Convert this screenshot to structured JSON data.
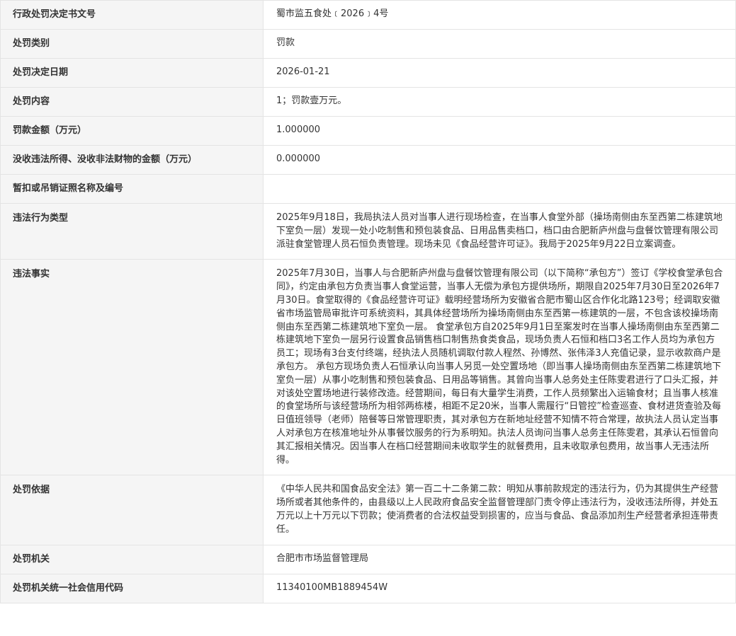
{
  "rows": [
    {
      "label": "行政处罚决定书文号",
      "value": "蜀市监五食处﹝2026﹞4号"
    },
    {
      "label": "处罚类别",
      "value": "罚款"
    },
    {
      "label": "处罚决定日期",
      "value": "2026-01-21"
    },
    {
      "label": "处罚内容",
      "value": "1；罚款壹万元。"
    },
    {
      "label": "罚款金额（万元）",
      "value": "1.000000"
    },
    {
      "label": "没收违法所得、没收非法财物的金额（万元）",
      "value": "0.000000"
    },
    {
      "label": "暂扣或吊销证照名称及编号",
      "value": ""
    },
    {
      "label": "违法行为类型",
      "value": "2025年9月18日，我局执法人员对当事人进行现场检查，在当事人食堂外部（操场南侧由东至西第二栋建筑地下室负一层）发现一处小吃制售和预包装食品、日用品售卖档口，档口由合肥新庐州盘与盘餐饮管理有限公司派驻食堂管理人员石恒负责管理。现场未见《食品经营许可证》。我局于2025年9月22日立案调查。"
    },
    {
      "label": "违法事实",
      "value": "2025年7月30日，当事人与合肥新庐州盘与盘餐饮管理有限公司（以下简称“承包方”）签订《学校食堂承包合同》，约定由承包方负责当事人食堂运营，当事人无偿为承包方提供场所，期限自2025年7月30日至2026年7月30日。食堂取得的《食品经营许可证》载明经营场所为安徽省合肥市蜀山区合作化北路123号；经调取安徽省市场监管局审批许可系统资料，其具体经营场所为操场南侧由东至西第一栋建筑的一层，不包含该校操场南侧由东至西第二栋建筑地下室负一层。 食堂承包方自2025年9月1日至案发时在当事人操场南侧由东至西第二栋建筑地下室负一层另行设置食品销售档口制售热食类食品，现场负责人石恒和档口3名工作人员均为承包方员工；现场有3台支付终端，经执法人员随机调取付款人程然、孙博然、张伟泽3人充值记录，显示收款商户是承包方。 承包方现场负责人石恒承认向当事人另觅一处空置场地（即当事人操场南侧由东至西第二栋建筑地下室负一层）从事小吃制售和预包装食品、日用品等销售。其曾向当事人总务处主任陈雯君进行了口头汇报，并对该处空置场地进行装修改造。经营期间，每日有大量学生消费，工作人员频繁出入运输食材；且当事人核准的食堂场所与该经营场所为相邻两栋楼，相距不足20米，当事人需履行“日管控”检查巡查、食材进货查验及每日值班领导（老师）陪餐等日常管理职责，其对承包方在新地址经营不知情不符合常理，故执法人员认定当事人对承包方在核准地址外从事餐饮服务的行为系明知。执法人员询问当事人总务主任陈雯君，其承认石恒曾向其汇报相关情况。因当事人在档口经营期间未收取学生的就餐费用，且未收取承包费用，故当事人无违法所得。"
    },
    {
      "label": "处罚依据",
      "value": "《中华人民共和国食品安全法》第一百二十二条第二款：明知从事前款规定的违法行为，仍为其提供生产经营场所或者其他条件的，由县级以上人民政府食品安全监督管理部门责令停止违法行为，没收违法所得，并处五万元以上十万元以下罚款；使消费者的合法权益受到损害的，应当与食品、食品添加剂生产经营者承担连带责任。"
    },
    {
      "label": "处罚机关",
      "value": "合肥市市场监督管理局"
    },
    {
      "label": "处罚机关统一社会信用代码",
      "value": "11340100MB1889454W"
    }
  ]
}
